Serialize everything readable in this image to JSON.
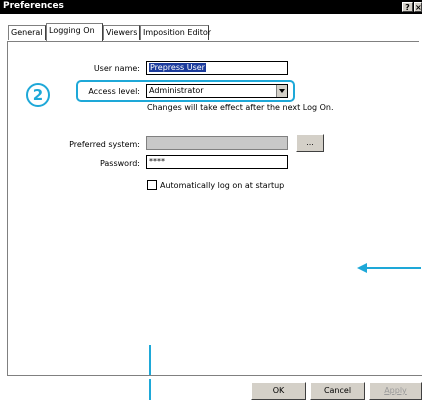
{
  "window": {
    "title": "Preferences",
    "help_glyph": "?",
    "close_glyph": "×"
  },
  "tabs": [
    {
      "label": "General"
    },
    {
      "label": "Logging On"
    },
    {
      "label": "Viewers"
    },
    {
      "label": "Imposition Editor"
    }
  ],
  "active_tab": "Logging On",
  "form": {
    "user_name_label": "User name:",
    "user_name_value": "Prepress User",
    "access_level_label": "Access level:",
    "access_level_value": "Administrator",
    "access_hint": "Changes will take effect after the next Log On.",
    "preferred_system_label": "Preferred system:",
    "preferred_system_value": "",
    "browse_label": "...",
    "password_label": "Password:",
    "password_value": "****",
    "auto_logon_label": "Automatically log on at startup",
    "auto_logon_checked": false
  },
  "buttons": {
    "ok": "OK",
    "cancel": "Cancel",
    "apply": "Apply"
  },
  "annotations": {
    "step_number": "2",
    "accent_color": "#1ea8d8"
  }
}
